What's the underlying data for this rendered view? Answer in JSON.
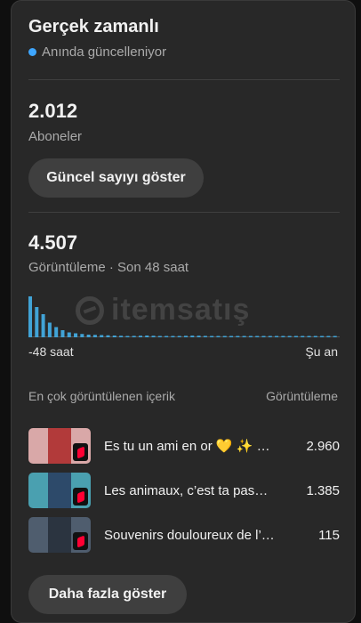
{
  "realtime": {
    "title": "Gerçek zamanlı",
    "live_label": "Anında güncelleniyor",
    "live_color": "#3ea6ff"
  },
  "subscribers": {
    "value": "2.012",
    "label": "Aboneler",
    "button_label": "Güncel sayıyı göster"
  },
  "views": {
    "value": "4.507",
    "label": "Görüntüleme · Son 48 saat",
    "axis_start": "-48 saat",
    "axis_end": "Şu an"
  },
  "chart_data": {
    "type": "bar",
    "x": [
      -48,
      -47,
      -46,
      -45,
      -44,
      -43,
      -42,
      -41,
      -40,
      -39,
      -38,
      -37,
      -36,
      -35,
      -34,
      -33,
      -32,
      -31,
      -30,
      -29,
      -28,
      -27,
      -26,
      -25,
      -24,
      -23,
      -22,
      -21,
      -20,
      -19,
      -18,
      -17,
      -16,
      -15,
      -14,
      -13,
      -12,
      -11,
      -10,
      -9,
      -8,
      -7,
      -6,
      -5,
      -4,
      -3,
      -2,
      -1
    ],
    "values": [
      920,
      680,
      520,
      330,
      230,
      160,
      110,
      90,
      75,
      60,
      55,
      50,
      45,
      40,
      35,
      30,
      32,
      36,
      40,
      35,
      30,
      28,
      26,
      30,
      34,
      38,
      36,
      32,
      28,
      26,
      24,
      22,
      26,
      30,
      28,
      24,
      22,
      20,
      24,
      26,
      22,
      20,
      18,
      20,
      22,
      20,
      18,
      16
    ],
    "color": "#41a3d6"
  },
  "watermark": {
    "text": "itemsatış"
  },
  "top_content": {
    "header_left": "En çok görüntülenen içerik",
    "header_right": "Görüntüleme",
    "rows": [
      {
        "title": "Es tu un ami en or 💛 ✨ …",
        "views": "2.960",
        "thumb_bg": "#d9a8a8",
        "thumb_fg": "#b23a3a"
      },
      {
        "title": "Les animaux, c’est ta pas…",
        "views": "1.385",
        "thumb_bg": "#4aa0b0",
        "thumb_fg": "#2d4a6a"
      },
      {
        "title": "Souvenirs douloureux de l’e…",
        "views": "115",
        "thumb_bg": "#4f5d6e",
        "thumb_fg": "#2b3440"
      }
    ]
  },
  "more_button_label": "Daha fazla göster"
}
